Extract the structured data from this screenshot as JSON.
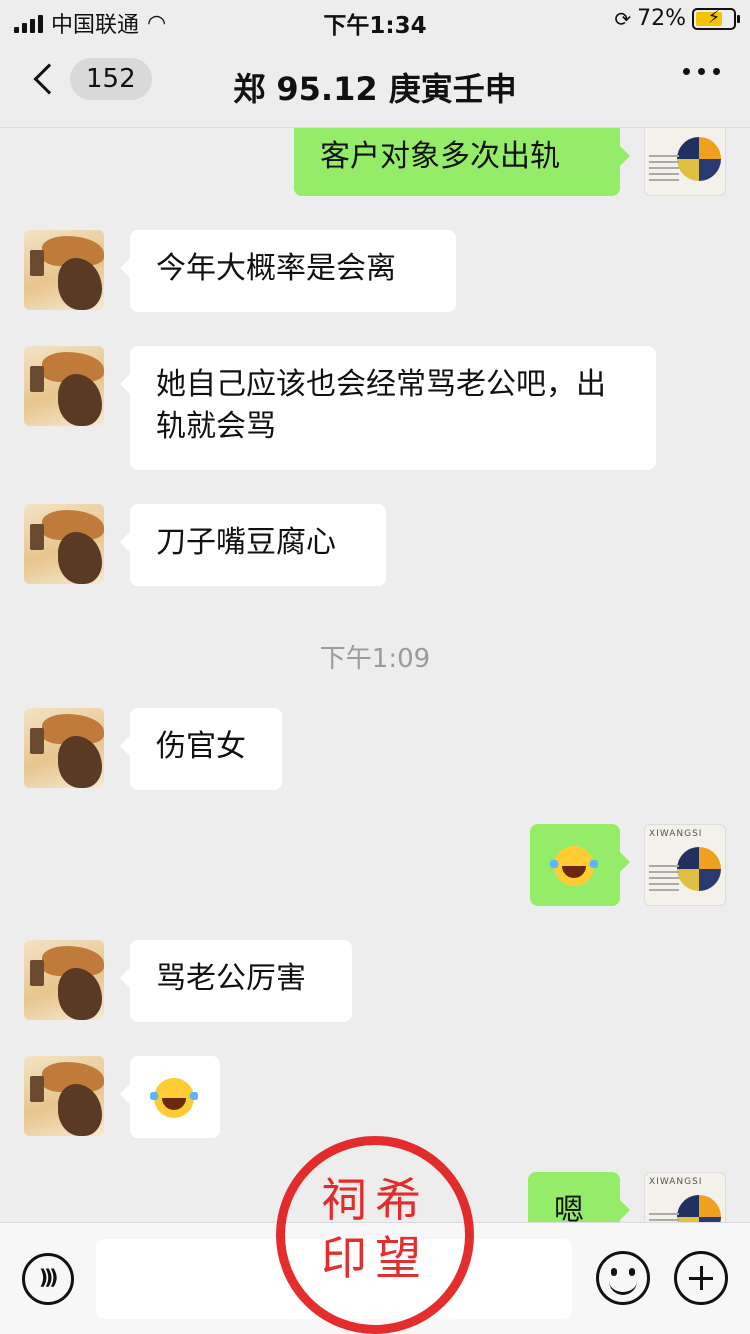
{
  "status_bar": {
    "carrier": "中国联通",
    "time": "下午1:34",
    "battery": "72%",
    "battery_level": 0.72
  },
  "nav": {
    "unread_count": "152",
    "title": "郑 95.12 庚寅壬申"
  },
  "messages": [
    {
      "side": "out",
      "text": "客户对象多次出轨"
    },
    {
      "side": "in",
      "text": "今年大概率是会离"
    },
    {
      "side": "in",
      "text": "她自己应该也会经常骂老公吧，出轨就会骂"
    },
    {
      "side": "in",
      "text": "刀子嘴豆腐心"
    },
    {
      "side": "in",
      "text": "伤官女"
    },
    {
      "side": "out",
      "emoji": "tears-of-joy-emoji"
    },
    {
      "side": "in",
      "text": "骂老公厉害"
    },
    {
      "side": "in",
      "emoji": "tears-of-joy-emoji"
    },
    {
      "side": "out",
      "text": "嗯"
    }
  ],
  "timestamp": "下午1:09",
  "avatar_me_brand": "XIWANGSI",
  "seal": {
    "line1": "祠希",
    "line2": "印望",
    "color": "#e21c1c"
  },
  "colors": {
    "bubble_out": "#95ec69",
    "bubble_in": "#ffffff",
    "background": "#ededed"
  }
}
